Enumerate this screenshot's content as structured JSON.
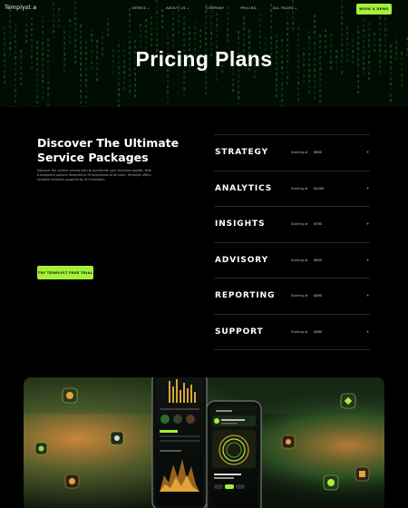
{
  "brand": {
    "name": "Templyst",
    "dot": ".",
    "suffix": "a"
  },
  "nav": {
    "items": [
      {
        "label": "Demos",
        "caret": "+"
      },
      {
        "label": "About us",
        "caret": "+"
      },
      {
        "label": "Company",
        "caret": ""
      },
      {
        "label": "Pricing",
        "caret": ""
      },
      {
        "label": "All pages",
        "caret": "+"
      }
    ],
    "cta": "BOOK A DEMO"
  },
  "hero": {
    "title": "Pricing Plans"
  },
  "intro": {
    "title": "Discover The Ultimate Service Packages",
    "text": "Discover the perfect pricing plan to accelerate your business growth. With transparent options designed to fit businesses of all sizes, Templyst offers scalable solutions powered by AI innovation.",
    "cta": "TRY TEMPLYST FREE TRIAL"
  },
  "services": [
    {
      "name": "STRATEGY",
      "starting": "Starting at",
      "price": "$900",
      "arrow": "+"
    },
    {
      "name": "ANALYTICS",
      "starting": "Starting at",
      "price": "$1200",
      "arrow": "+"
    },
    {
      "name": "INSIGHTS",
      "starting": "Starting at",
      "price": "$750",
      "arrow": "+"
    },
    {
      "name": "ADVISORY",
      "starting": "Starting at",
      "price": "$950",
      "arrow": "+"
    },
    {
      "name": "REPORTING",
      "starting": "Starting at",
      "price": "$490",
      "arrow": "+"
    },
    {
      "name": "SUPPORT",
      "starting": "Starting at",
      "price": "$560",
      "arrow": "+"
    }
  ],
  "colors": {
    "accent": "#a6ef3a",
    "background": "#000000",
    "matrix": "#1f7a32"
  }
}
